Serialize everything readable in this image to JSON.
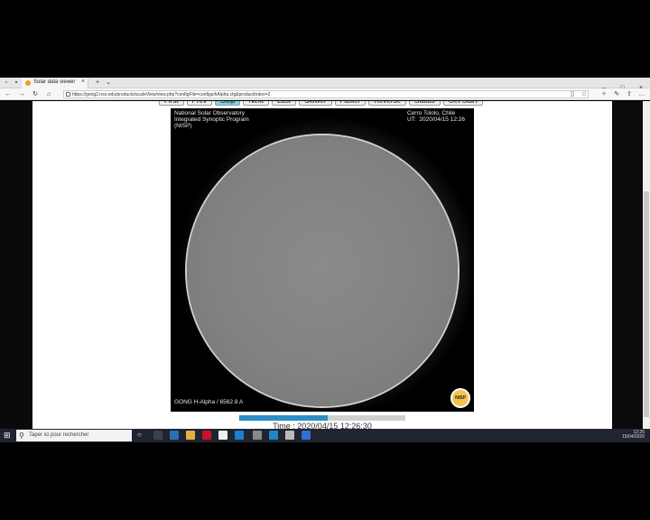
{
  "browser": {
    "tab_title": "Solar data viewer",
    "tab_close": "×",
    "new_tab": "+",
    "address": "https://gong2.nso.edu/products/scaleView/view.php?configFile=configs/hAlpha.cfg&productIndex=2",
    "win_min": "–",
    "win_max": "□",
    "win_close": "×"
  },
  "controls": {
    "buttons": [
      "First",
      "Prev",
      "Stop",
      "Next",
      "Last",
      "Slower",
      "Faster",
      "Reverse",
      "Status",
      "Get Start"
    ],
    "active_index": 2
  },
  "viewer": {
    "org_line1": "National Solar Observatory",
    "org_line2": "Integrated Synoptic Program",
    "org_line3": "(NISP)",
    "site": "Cerro Tololo, Chile",
    "ut": "UT:  2020/04/15 12:26",
    "caption": "GONG H-Alpha / 6562.8 A",
    "logo": "NISP"
  },
  "progress": {
    "fraction": 0.53
  },
  "time_label": "Time : 2020/04/15 12:26:30",
  "taskbar": {
    "search_placeholder": "Taper ici pour rechercher",
    "tray_time": "12:26",
    "tray_date": "15/04/2020"
  },
  "colors": {
    "accent": "#2b8ec4",
    "active_button": "#7fd3e8"
  }
}
